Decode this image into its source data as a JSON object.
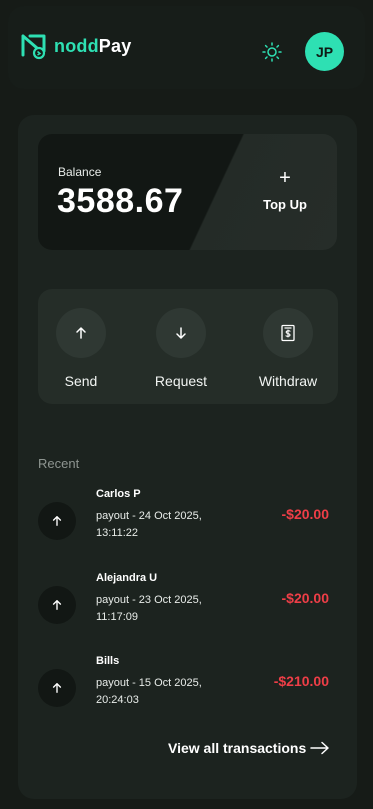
{
  "brand": {
    "name_part1": "nodd",
    "name_part2": "Pay",
    "logo_icon": "noddpay-logo-icon",
    "accent": "#2ee0b3"
  },
  "header": {
    "theme_icon": "sun-icon",
    "avatar_initials": "JP"
  },
  "balance": {
    "label": "Balance",
    "value": "3588.67",
    "topup_icon": "plus-icon",
    "topup_label": "Top Up"
  },
  "actions": [
    {
      "label": "Send",
      "icon": "arrow-up-icon"
    },
    {
      "label": "Request",
      "icon": "arrow-down-icon"
    },
    {
      "label": "Withdraw",
      "icon": "receipt-dollar-icon"
    }
  ],
  "recent": {
    "title": "Recent",
    "transactions": [
      {
        "name": "Carlos P",
        "detail": "payout - 24 Oct 2025, 13:11:22",
        "amount": "-$20.00",
        "icon": "arrow-up-icon"
      },
      {
        "name": "Alejandra U",
        "detail": "payout - 23 Oct 2025, 11:17:09",
        "amount": "-$20.00",
        "icon": "arrow-up-icon"
      },
      {
        "name": "Bills",
        "detail": "payout - 15 Oct 2025, 20:24:03",
        "amount": "-$210.00",
        "icon": "arrow-up-icon"
      }
    ],
    "view_all_label": "View all transactions",
    "view_all_icon": "arrow-right-icon",
    "negative_color": "#ee3e47"
  }
}
